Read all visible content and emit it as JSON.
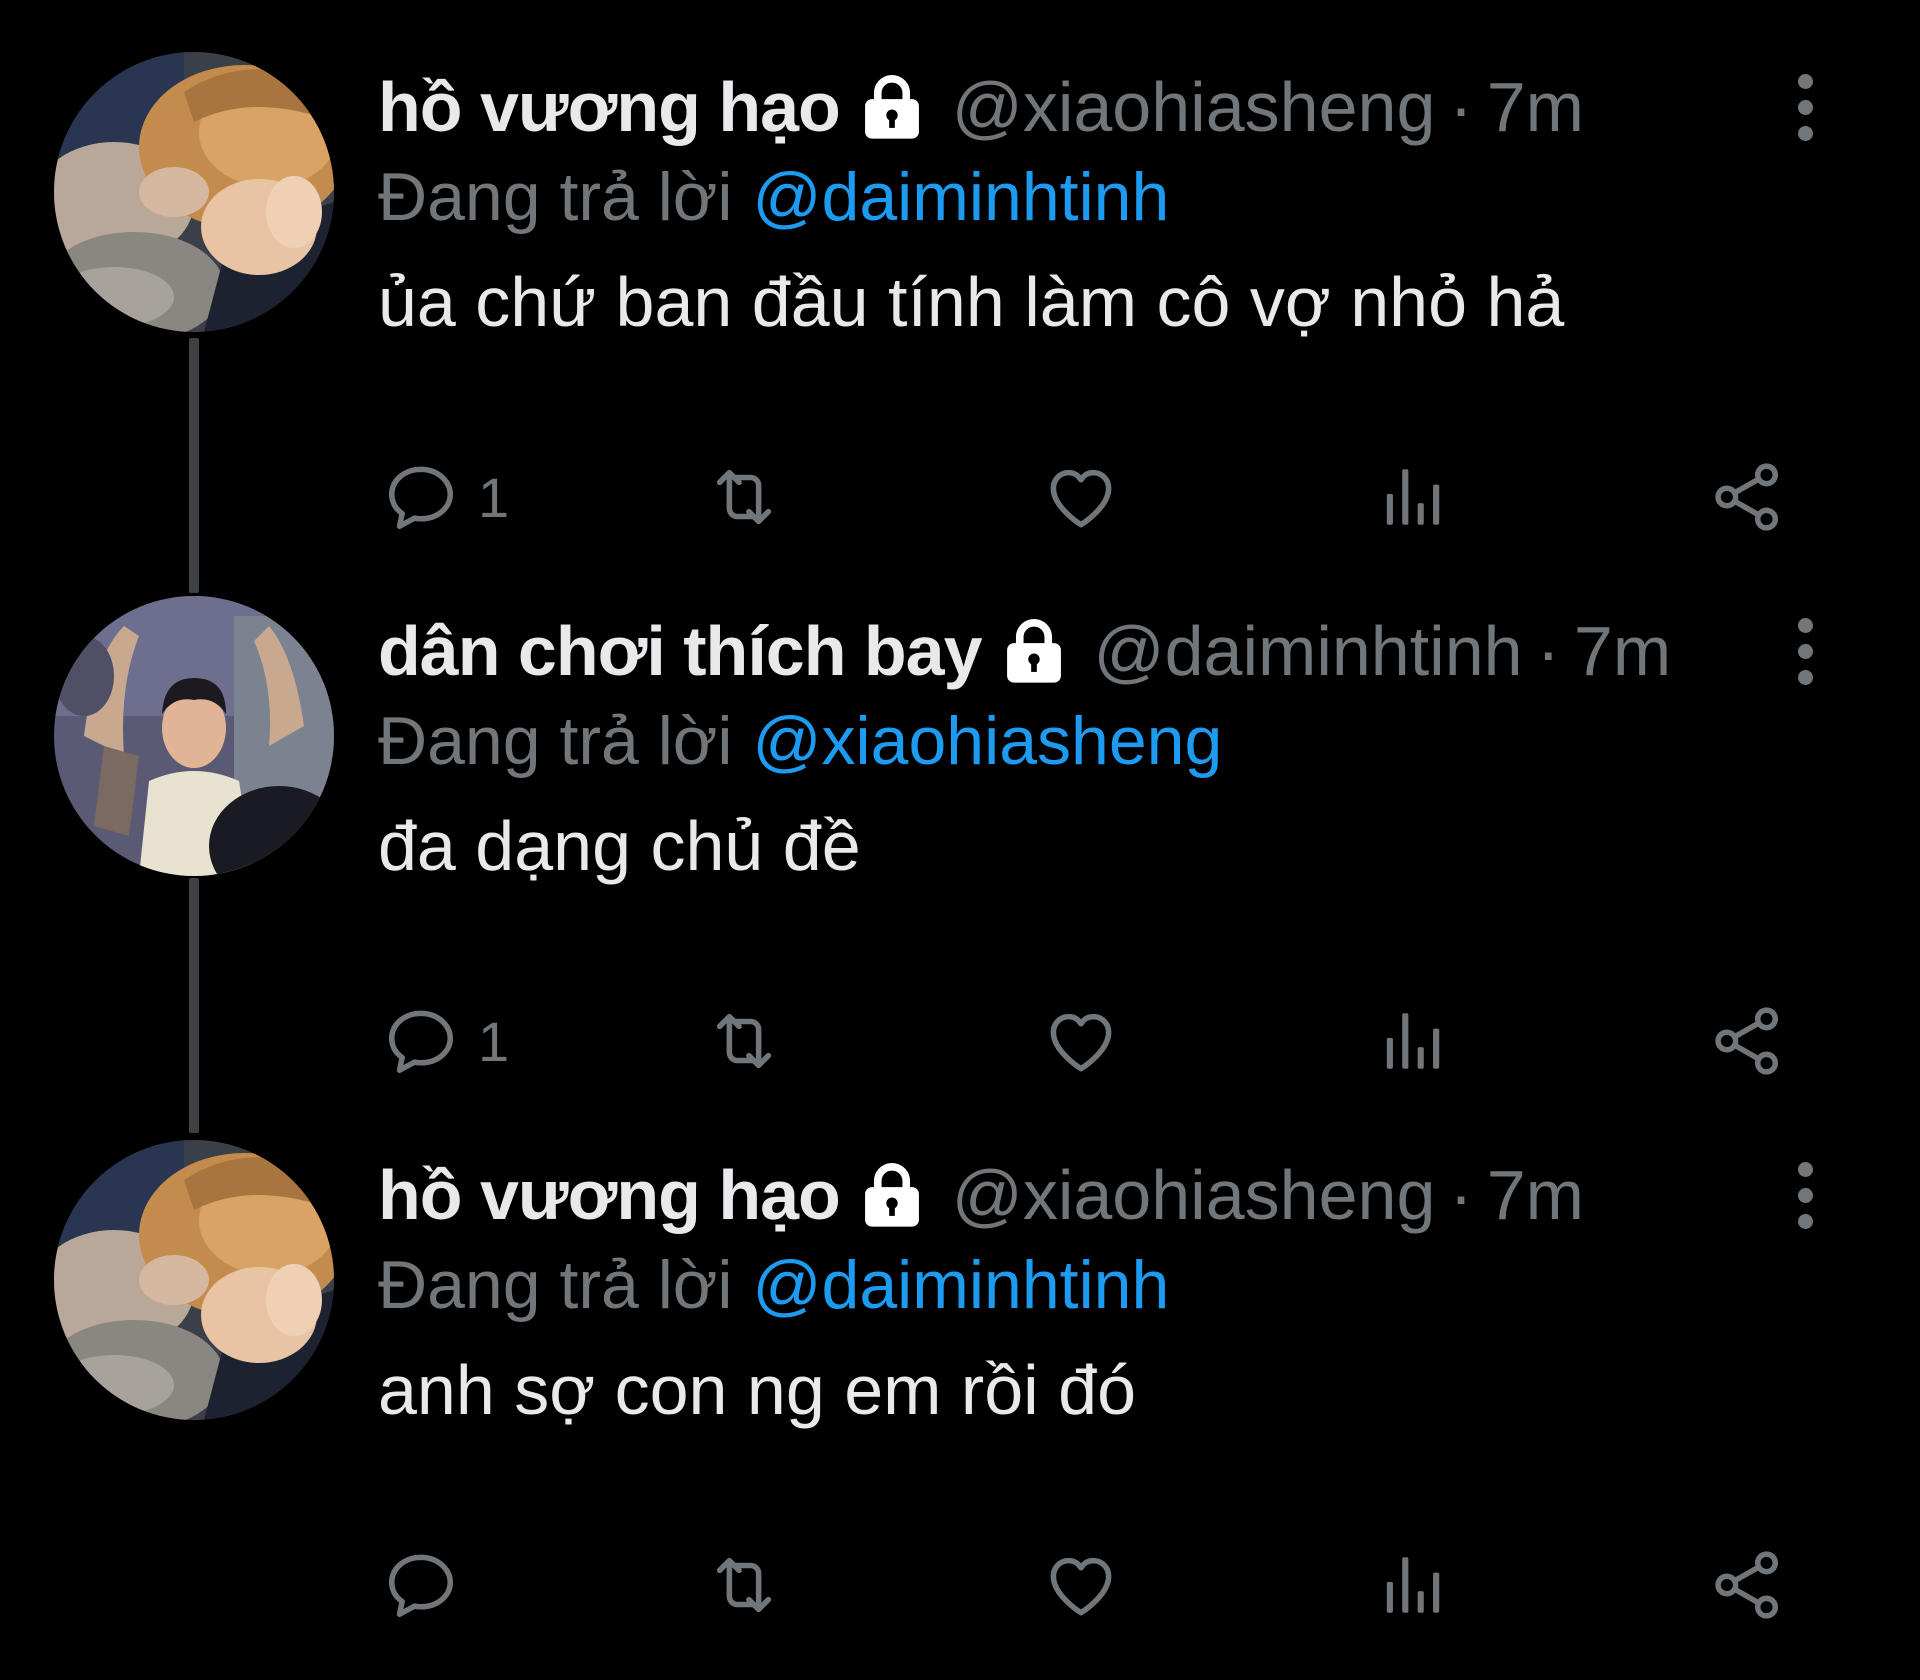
{
  "colors": {
    "background": "#000000",
    "primary_text": "#e7e9ea",
    "secondary_text": "#71767b",
    "accent": "#1d9bf0",
    "thread_line": "#3e4144"
  },
  "icons": {
    "protected": "lock-icon",
    "more": "more-vertical-icon",
    "reply": "reply-icon",
    "retweet": "retweet-icon",
    "like": "heart-icon",
    "views": "analytics-icon",
    "share": "share-icon"
  },
  "tweets": [
    {
      "display_name": "hồ vương hạo",
      "handle": "@xiaohiasheng",
      "separator": "·",
      "time": "7m",
      "reply_prefix": "Đang trả lời",
      "reply_to": "@daiminhtinh",
      "text": "ủa chứ ban đầu tính làm cô vợ nhỏ hả",
      "reply_count": "1"
    },
    {
      "display_name": "dân chơi thích bay",
      "handle": "@daiminhtinh",
      "separator": "·",
      "time": "7m",
      "reply_prefix": "Đang trả lời",
      "reply_to": "@xiaohiasheng",
      "text": "đa dạng chủ đề",
      "reply_count": "1"
    },
    {
      "display_name": "hồ vương hạo",
      "handle": "@xiaohiasheng",
      "separator": "·",
      "time": "7m",
      "reply_prefix": "Đang trả lời",
      "reply_to": "@daiminhtinh",
      "text": "anh sợ con ng em rồi đó",
      "reply_count": ""
    }
  ]
}
